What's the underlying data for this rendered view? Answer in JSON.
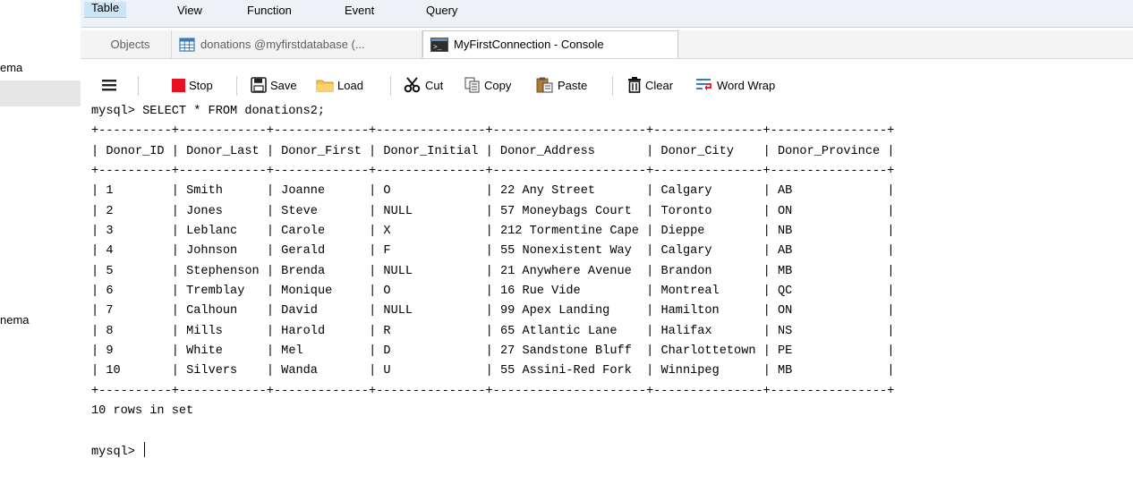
{
  "sidebar": {
    "schema_label_1": "ema",
    "schema_label_2": "nema"
  },
  "menu": [
    "Table",
    "View",
    "Function",
    "Event",
    "Query"
  ],
  "tabs": {
    "objects": "Objects",
    "table_tab": "donations @myfirstdatabase (...",
    "console_tab": "MyFirstConnection - Console"
  },
  "toolbar": {
    "stop": "Stop",
    "save": "Save",
    "load": "Load",
    "cut": "Cut",
    "copy": "Copy",
    "paste": "Paste",
    "clear": "Clear",
    "word_wrap": "Word Wrap"
  },
  "console": {
    "prompt": "mysql>",
    "command": "SELECT * FROM donations2;",
    "columns": [
      "Donor_ID",
      "Donor_Last",
      "Donor_First",
      "Donor_Initial",
      "Donor_Address",
      "Donor_City",
      "Donor_Province"
    ],
    "visible_header_suffix": "Donor_Pro",
    "rows": [
      [
        "1",
        "Smith",
        "Joanne",
        "O",
        "22 Any Street",
        "Calgary",
        "AB"
      ],
      [
        "2",
        "Jones",
        "Steve",
        "NULL",
        "57 Moneybags Court",
        "Toronto",
        "ON"
      ],
      [
        "3",
        "Leblanc",
        "Carole",
        "X",
        "212 Tormentine Cape",
        "Dieppe",
        "NB"
      ],
      [
        "4",
        "Johnson",
        "Gerald",
        "F",
        "55 Nonexistent Way",
        "Calgary",
        "AB"
      ],
      [
        "5",
        "Stephenson",
        "Brenda",
        "NULL",
        "21 Anywhere Avenue",
        "Brandon",
        "MB"
      ],
      [
        "6",
        "Tremblay",
        "Monique",
        "O",
        "16 Rue Vide",
        "Montreal",
        "QC"
      ],
      [
        "7",
        "Calhoun",
        "David",
        "NULL",
        "99 Apex Landing",
        "Hamilton",
        "ON"
      ],
      [
        "8",
        "Mills",
        "Harold",
        "R",
        "65 Atlantic Lane",
        "Halifax",
        "NS"
      ],
      [
        "9",
        "White",
        "Mel",
        "D",
        "27 Sandstone Bluff",
        "Charlottetown",
        "PE"
      ],
      [
        "10",
        "Silvers",
        "Wanda",
        "U",
        "55 Assini-Red Fork",
        "Winnipeg",
        "MB"
      ]
    ],
    "summary": "10 rows in set"
  },
  "colors": {
    "menu_bg": "#eef2f7",
    "tab_bg": "#f3f3f3",
    "stop_red": "#e81123"
  },
  "icons": [
    "hamburger-menu-icon",
    "stop-icon",
    "save-icon",
    "load-folder-icon",
    "cut-icon",
    "copy-icon",
    "paste-icon",
    "clear-icon",
    "word-wrap-icon",
    "table-icon",
    "console-icon"
  ]
}
